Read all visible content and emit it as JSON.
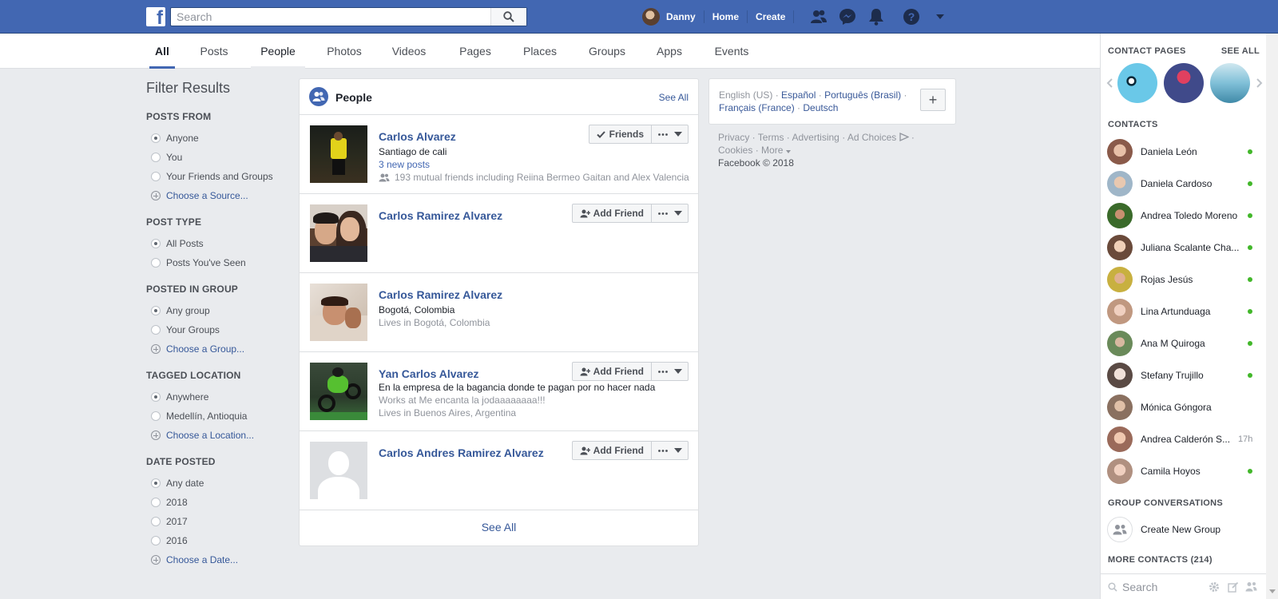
{
  "topbar": {
    "logo": "f",
    "search_placeholder": "Search",
    "user_name": "Danny",
    "home": "Home",
    "create": "Create",
    "icons": [
      "friends-icon",
      "messenger-icon",
      "notifications-icon",
      "help-icon",
      "account-menu-icon"
    ]
  },
  "tabs": [
    "All",
    "Posts",
    "People",
    "Photos",
    "Videos",
    "Pages",
    "Places",
    "Groups",
    "Apps",
    "Events"
  ],
  "filters": {
    "title": "Filter Results",
    "posts_from": {
      "heading": "POSTS FROM",
      "options": [
        "Anyone",
        "You",
        "Your Friends and Groups"
      ],
      "link": "Choose a Source..."
    },
    "post_type": {
      "heading": "POST TYPE",
      "options": [
        "All Posts",
        "Posts You've Seen"
      ]
    },
    "posted_in_group": {
      "heading": "POSTED IN GROUP",
      "options": [
        "Any group",
        "Your Groups"
      ],
      "link": "Choose a Group..."
    },
    "tagged_location": {
      "heading": "TAGGED LOCATION",
      "options": [
        "Anywhere",
        "Medellín, Antioquia"
      ],
      "link": "Choose a Location..."
    },
    "date_posted": {
      "heading": "DATE POSTED",
      "options": [
        "Any date",
        "2018",
        "2017",
        "2016"
      ],
      "link": "Choose a Date..."
    }
  },
  "people": {
    "title": "People",
    "see_all": "See All",
    "footer": "See All",
    "results": [
      {
        "name": "Carlos Alvarez",
        "line1": "Santiago de cali",
        "line2": "3 new posts",
        "line3": "193 mutual friends including Reiina Bermeo Gaitan and Alex Valencia",
        "button": "Friends"
      },
      {
        "name": "Carlos Ramirez Alvarez",
        "button": "Add Friend"
      },
      {
        "name": "Carlos Ramirez Alvarez",
        "line1": "Bogotá, Colombia",
        "line2": "Lives in Bogotá, Colombia"
      },
      {
        "name": "Yan Carlos Alvarez",
        "line1": "En la empresa de la bagancia donde te pagan por no hacer nada",
        "line2": "Works at Me encanta la jodaaaaaaaa!!!",
        "line3": "Lives in Buenos Aires, Argentina",
        "button": "Add Friend"
      },
      {
        "name": "Carlos Andres Ramirez Alvarez",
        "button": "Add Friend"
      }
    ]
  },
  "languages": {
    "current": "English (US)",
    "others": [
      "Español",
      "Português (Brasil)",
      "Français (France)",
      "Deutsch"
    ],
    "plus": "+"
  },
  "footer": {
    "links": [
      "Privacy",
      "Terms",
      "Advertising",
      "Ad Choices",
      "Cookies",
      "More"
    ],
    "copyright": "Facebook © 2018"
  },
  "chat": {
    "contact_pages": "CONTACT PAGES",
    "see_all": "SEE ALL",
    "contacts_heading": "CONTACTS",
    "contacts": [
      {
        "name": "Daniela León",
        "online": true,
        "color": "#8a5a4a"
      },
      {
        "name": "Daniela Cardoso",
        "online": true,
        "color": "#9fb6c8"
      },
      {
        "name": "Andrea Toledo Moreno",
        "online": true,
        "color": "#3a6a2a"
      },
      {
        "name": "Juliana Scalante Cha...",
        "online": true,
        "color": "#6a4a3a"
      },
      {
        "name": "Rojas Jesús",
        "online": true,
        "color": "#c8b040"
      },
      {
        "name": "Lina Artunduaga",
        "online": true,
        "color": "#c09880"
      },
      {
        "name": "Ana M Quiroga",
        "online": true,
        "color": "#6a8a5a"
      },
      {
        "name": "Stefany Trujillo",
        "online": true,
        "color": "#c0b0a8"
      },
      {
        "name": "Mónica Góngora",
        "online": false,
        "color": "#8a7060"
      },
      {
        "name": "Andrea Calderón S...",
        "online": false,
        "time": "17h",
        "color": "#9a6a5a"
      },
      {
        "name": "Camila Hoyos",
        "online": true,
        "color": "#b09080"
      }
    ],
    "group_conversations": "GROUP CONVERSATIONS",
    "create_group": "Create New Group",
    "more_contacts": "MORE CONTACTS (214)",
    "search_placeholder": "Search"
  }
}
